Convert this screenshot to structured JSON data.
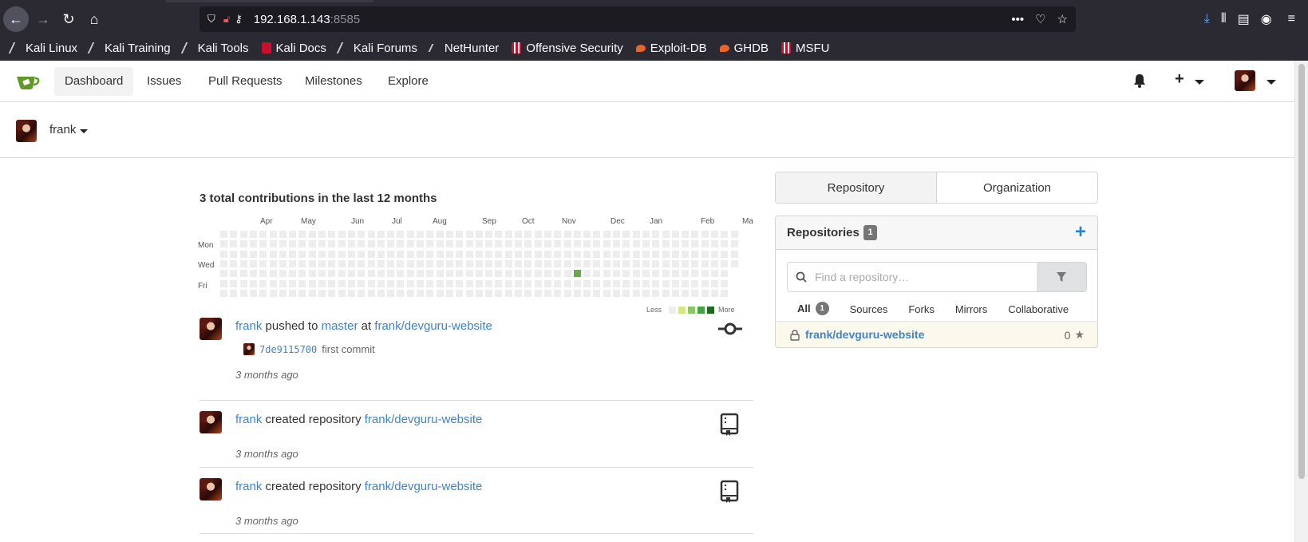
{
  "browser": {
    "url_host": "192.168.1.143",
    "url_port": ":8585",
    "bookmarks": [
      "Kali Linux",
      "Kali Training",
      "Kali Tools",
      "Kali Docs",
      "Kali Forums",
      "NetHunter",
      "Offensive Security",
      "Exploit-DB",
      "GHDB",
      "MSFU"
    ]
  },
  "nav": {
    "items": [
      "Dashboard",
      "Issues",
      "Pull Requests",
      "Milestones",
      "Explore"
    ],
    "active": "Dashboard"
  },
  "user": {
    "name": "frank"
  },
  "contributions": {
    "title": "3 total contributions in the last 12 months",
    "months": [
      "Apr",
      "May",
      "Jun",
      "Jul",
      "Aug",
      "Sep",
      "Oct",
      "Nov",
      "Dec",
      "Jan",
      "Feb",
      "Ma"
    ],
    "day_labels": [
      "Mon",
      "Wed",
      "Fri"
    ],
    "legend_less": "Less",
    "legend_more": "More",
    "legend_colors": [
      "#ededed",
      "#d6e685",
      "#8cc665",
      "#44a340",
      "#1e6823"
    ],
    "active_color": "#6aa84f"
  },
  "feed": [
    {
      "user": "frank",
      "action": "pushed to",
      "branch": "master",
      "at": "at",
      "repo": "frank/devguru-website",
      "commit_sha": "7de9115700",
      "commit_msg": "first commit",
      "time": "3 months ago",
      "icon": "git-commit-icon"
    },
    {
      "user": "frank",
      "action": "created repository",
      "repo": "frank/devguru-website",
      "time": "3 months ago",
      "icon": "repo-book-icon"
    },
    {
      "user": "frank",
      "action": "created repository",
      "repo": "frank/devguru-website",
      "time": "3 months ago",
      "icon": "repo-book-icon"
    }
  ],
  "sidebar": {
    "tabs": [
      "Repository",
      "Organization"
    ],
    "repos_title": "Repositories",
    "repos_count": "1",
    "search_placeholder": "Find a repository…",
    "subtabs": [
      "All",
      "Sources",
      "Forks",
      "Mirrors",
      "Collaborative"
    ],
    "all_count": "1",
    "repo_name": "frank/devguru-website",
    "repo_stars": "0"
  }
}
